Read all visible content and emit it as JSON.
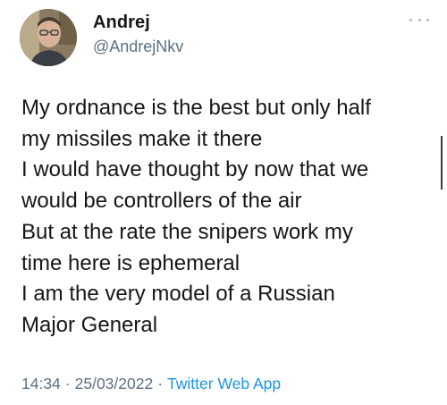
{
  "user": {
    "display_name": "Andrej",
    "username": "@AndrejNkv"
  },
  "tweet": {
    "lines": [
      "My ordnance is the best but only half",
      "my missiles make it there",
      "I would have thought by now that we",
      "would be controllers of the air",
      "But at the rate the snipers work my",
      "time here is ephemeral",
      "I am the very model of a Russian",
      "Major General"
    ]
  },
  "meta": {
    "time": "14:34",
    "separator": "·",
    "date": "25/03/2022",
    "source": "Twitter Web App"
  },
  "icons": {
    "more": "more-dots-icon",
    "avatar": "profile-photo"
  },
  "colors": {
    "text": "#14171a",
    "secondary": "#5b7083",
    "link": "#1b95e0"
  }
}
